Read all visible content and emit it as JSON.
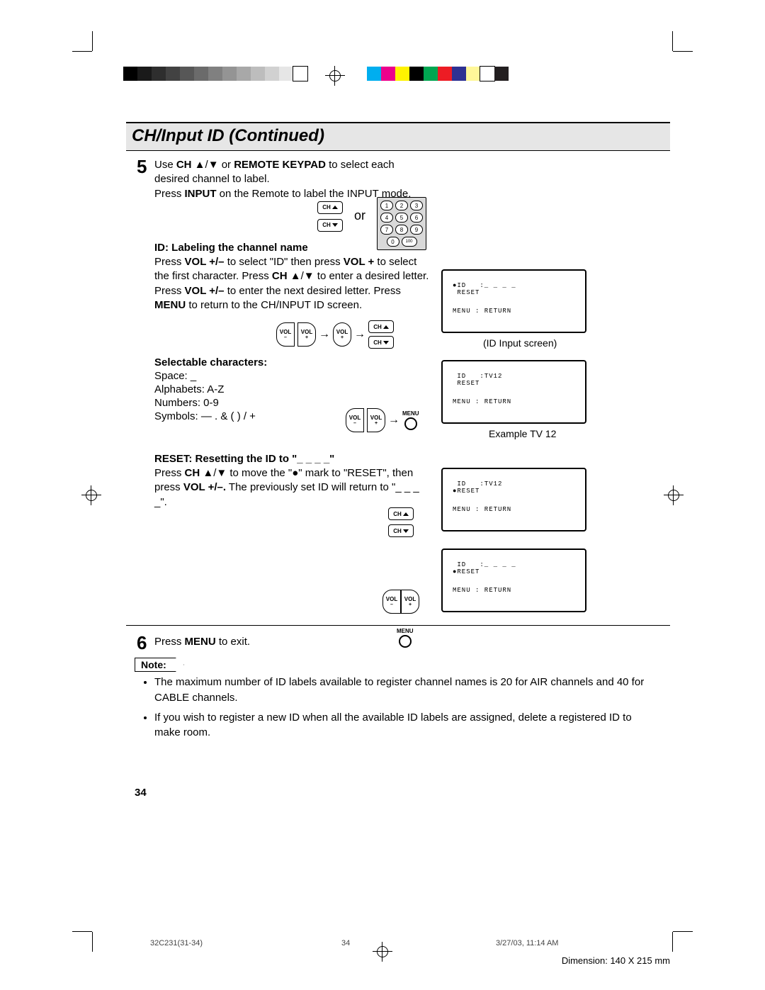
{
  "printer_marks": {
    "grayscale_swatches": [
      "#000000",
      "#1a1a1a",
      "#2e2e2e",
      "#424242",
      "#575757",
      "#6b6b6b",
      "#808080",
      "#949494",
      "#a8a8a8",
      "#bdbdbd",
      "#d1d1d1",
      "#e6e6e6",
      "#ffffff"
    ],
    "color_swatches": [
      "#00aeef",
      "#ec008c",
      "#fff200",
      "#000000",
      "#00a651",
      "#ed1c24",
      "#2e3192",
      "#fff799",
      "#ffffff",
      "#231f20"
    ]
  },
  "header": {
    "title": "CH/Input ID (Continued)"
  },
  "step5": {
    "number": "5",
    "text_pre": "Use ",
    "ch_bold": "CH",
    "text_mid1": " ▲/▼ or ",
    "remote_bold": "REMOTE KEYPAD",
    "text_mid2": " to select each desired channel to label.",
    "text_line2_pre": "Press ",
    "input_bold": "INPUT",
    "text_line2_post": " on the Remote to label the INPUT mode.",
    "or": "or",
    "keypad": [
      "1",
      "2",
      "3",
      "4",
      "5",
      "6",
      "7",
      "8",
      "9",
      "0",
      "100"
    ]
  },
  "id_section": {
    "heading": "ID: Labeling the channel name",
    "p1_pre": "Press ",
    "volpm1": "VOL +/–",
    "p1_mid1": " to select \"ID\" then press ",
    "volp": "VOL +",
    "p1_mid2": " to select the first character. Press ",
    "ch": "CH",
    "p1_mid3": " ▲/▼ to enter a desired letter. Press ",
    "volpm2": "VOL +/–",
    "p1_mid4": " to enter the next desired letter. Press ",
    "menu": "MENU",
    "p1_post": " to return to the CH/INPUT ID screen."
  },
  "selectable": {
    "heading": "Selectable characters:",
    "space": "Space: _",
    "alpha": "Alphabets: A-Z",
    "nums": "Numbers: 0-9",
    "syms": "Symbols: —   .   &   (   )   /   +"
  },
  "reset_section": {
    "heading": "RESET: Resetting the ID to \"_ _ _ _\"",
    "p_pre": "Press ",
    "ch": "CH",
    "p_mid1": " ▲/▼ to move the \"●\" mark to \"RESET\", then press ",
    "vol": "VOL +/–.",
    "p_post": " The previously set ID will return to \"_ _ _ _\"."
  },
  "step6": {
    "number": "6",
    "pre": "Press ",
    "menu": "MENU",
    "post": " to exit."
  },
  "osd1": {
    "l1": "●ID   :_ _ _ _",
    "l2": " RESET",
    "l3": "MENU : RETURN",
    "caption": "(ID Input screen)"
  },
  "osd2": {
    "l1": " ID   :TV12",
    "l2": " RESET",
    "l3": "MENU : RETURN",
    "caption": "Example TV 12"
  },
  "osd3": {
    "l1": " ID   :TV12",
    "l2": "●RESET",
    "l3": "MENU : RETURN"
  },
  "osd4": {
    "l1": " ID   :_ _ _ _",
    "l2": "●RESET",
    "l3": "MENU : RETURN"
  },
  "buttons": {
    "ch": "CH",
    "vol": "VOL",
    "menu": "MENU"
  },
  "note": {
    "label": "Note:",
    "b1": "The maximum number of ID labels available to register channel names is 20 for AIR channels and 40 for CABLE channels.",
    "b2": "If you wish to register a new ID when all the available ID labels are assigned, delete a registered ID to make room."
  },
  "footer": {
    "page_num": "34",
    "doc_id": "32C231(31-34)",
    "center": "34",
    "timestamp": "3/27/03, 11:14 AM",
    "dimension": "Dimension: 140  X 215 mm"
  }
}
